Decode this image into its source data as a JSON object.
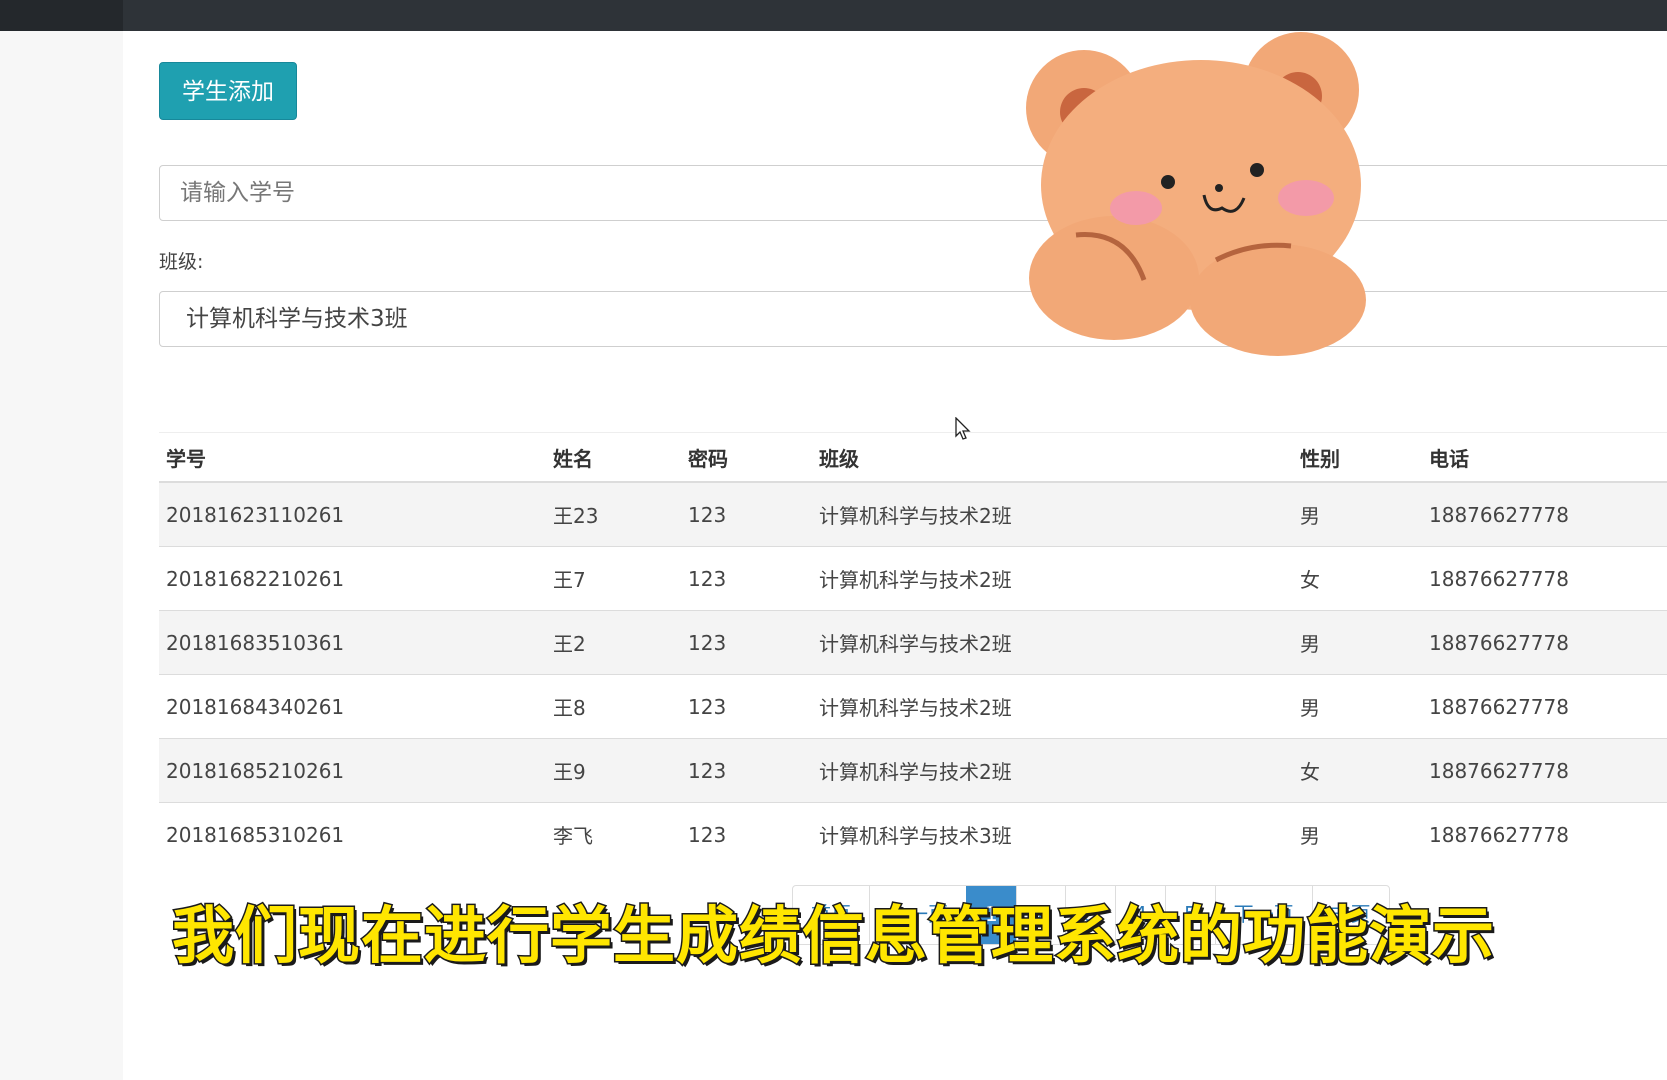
{
  "toolbar": {
    "add_student_label": "学生添加"
  },
  "search": {
    "placeholder": "请输入学号"
  },
  "class_filter": {
    "label": "班级:",
    "selected": "计算机科学与技术3班"
  },
  "table": {
    "headers": {
      "id": "学号",
      "name": "姓名",
      "password": "密码",
      "class": "班级",
      "gender": "性别",
      "phone": "电话"
    },
    "rows": [
      {
        "id": "20181623110261",
        "name": "王23",
        "password": "123",
        "class": "计算机科学与技术2班",
        "gender": "男",
        "phone": "18876627778"
      },
      {
        "id": "20181682210261",
        "name": "王7",
        "password": "123",
        "class": "计算机科学与技术2班",
        "gender": "女",
        "phone": "18876627778"
      },
      {
        "id": "20181683510361",
        "name": "王2",
        "password": "123",
        "class": "计算机科学与技术2班",
        "gender": "男",
        "phone": "18876627778"
      },
      {
        "id": "20181684340261",
        "name": "王8",
        "password": "123",
        "class": "计算机科学与技术2班",
        "gender": "男",
        "phone": "18876627778"
      },
      {
        "id": "20181685210261",
        "name": "王9",
        "password": "123",
        "class": "计算机科学与技术2班",
        "gender": "女",
        "phone": "18876627778"
      },
      {
        "id": "20181685310261",
        "name": "李飞",
        "password": "123",
        "class": "计算机科学与技术3班",
        "gender": "男",
        "phone": "18876627778"
      }
    ]
  },
  "pagination": {
    "first": "首页",
    "prev": "上一页",
    "pages": [
      "1",
      "2",
      "3",
      "4",
      "5"
    ],
    "active_page": "1",
    "next": "下一页",
    "last": "末页"
  },
  "overlay": {
    "subtitle": "我们现在进行学生成绩信息管理系统的功能演示",
    "sticker_icon": "teddy-bear-sticker"
  },
  "colors": {
    "primary_button": "#1fa0b0",
    "pager_active": "#3a8ccb",
    "subtitle_fill": "#ffe600"
  }
}
